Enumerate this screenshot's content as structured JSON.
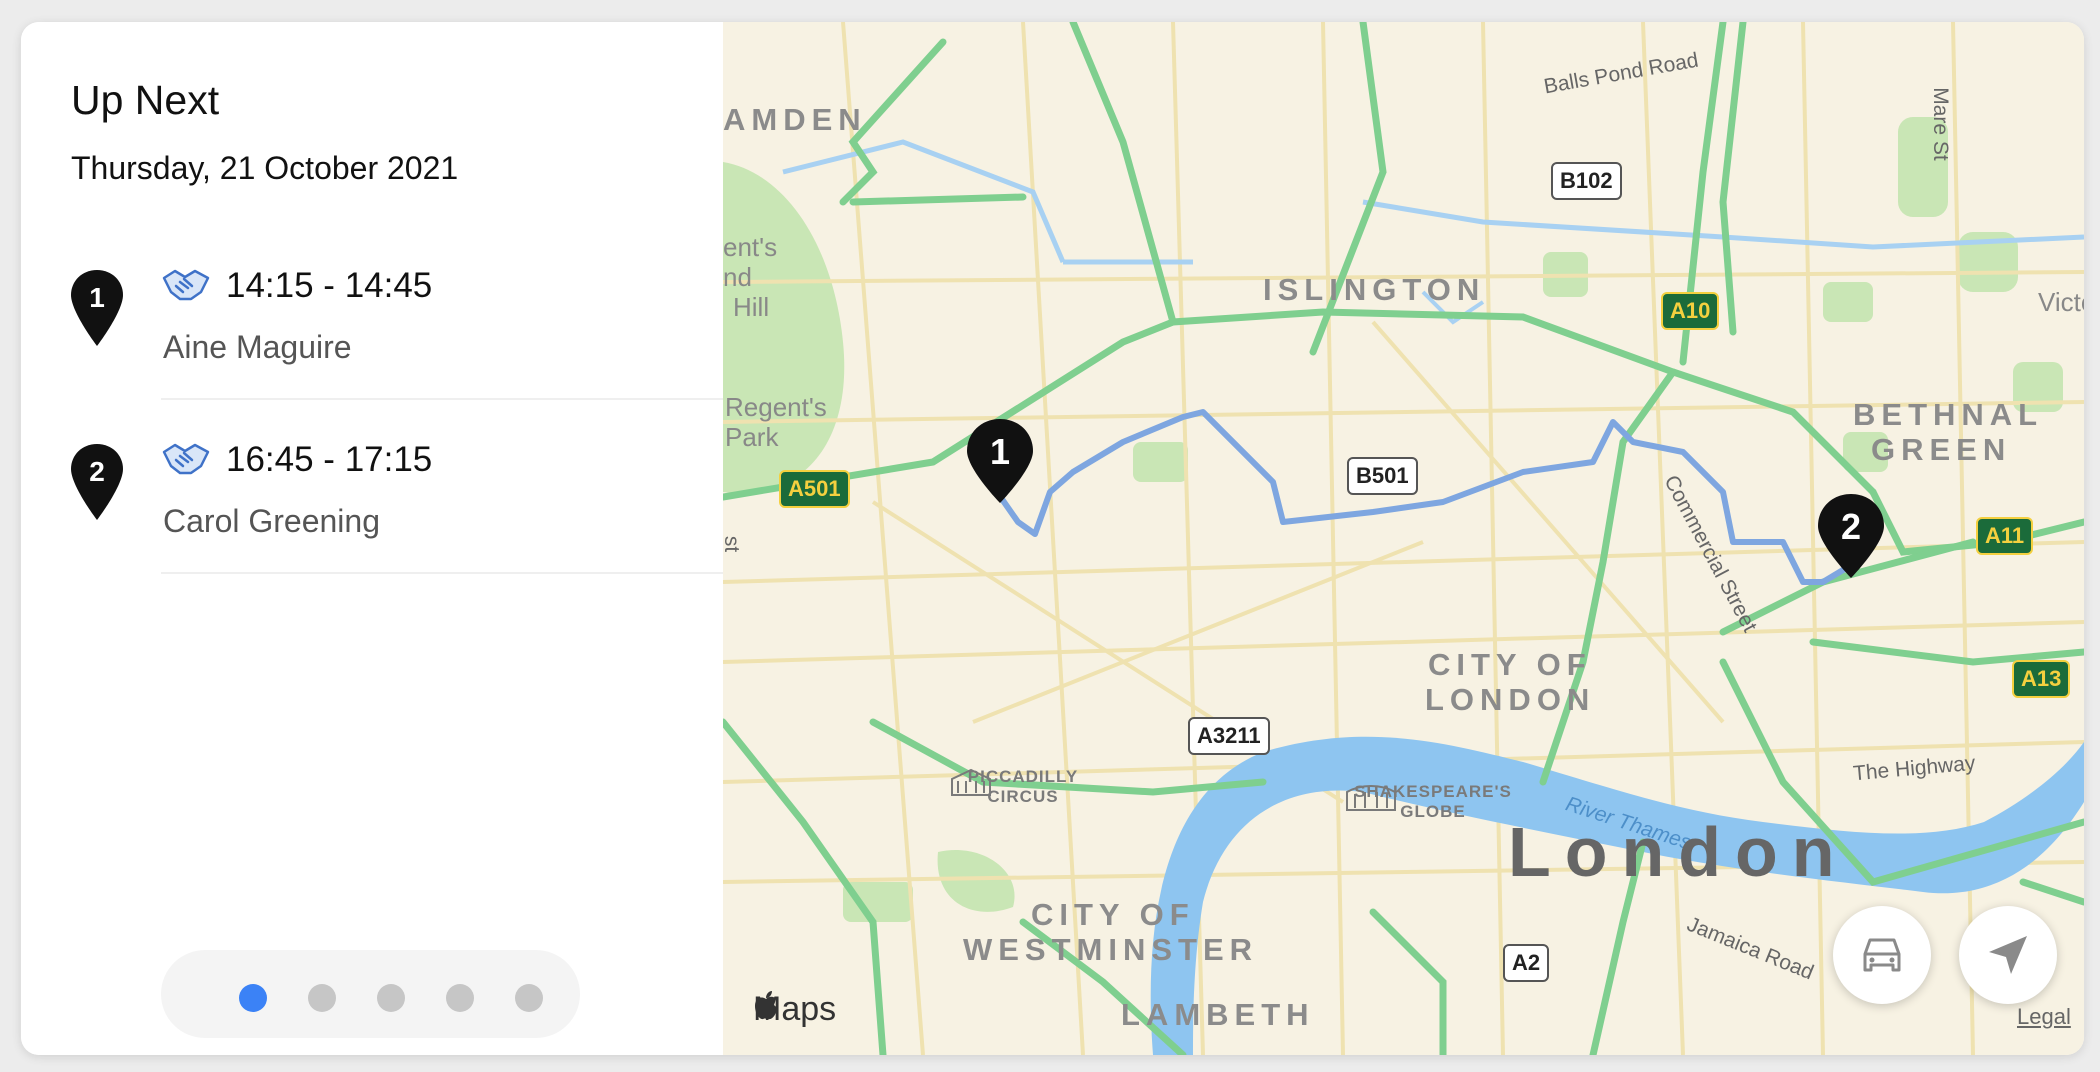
{
  "panel": {
    "title": "Up Next",
    "date": "Thursday, 21 October 2021",
    "items": [
      {
        "number": "1",
        "time": "14:15 - 14:45",
        "name": "Aine Maguire"
      },
      {
        "number": "2",
        "time": "16:45 - 17:15",
        "name": "Carol Greening"
      }
    ],
    "pages": {
      "count": 5,
      "active": 1
    }
  },
  "map": {
    "areas": {
      "camden": "AMDEN",
      "islington": "ISLINGTON",
      "bethnal_green_1": "BETHNAL",
      "bethnal_green_2": "GREEN",
      "city_of_london_1": "CITY OF",
      "city_of_london_2": "LONDON",
      "westminster_1": "CITY OF",
      "westminster_2": "WESTMINSTER",
      "lambeth": "LAMBETH",
      "victoria": "Victo",
      "regents_park_1": "Regent's",
      "regents_park_2": "Park",
      "kentish_1": "ent's",
      "kentish_2": "nd",
      "kentish_3": "Hill"
    },
    "roads": {
      "balls_pond": "Balls Pond Road",
      "mare_st": "Mare St",
      "commercial_st": "Commercial Street",
      "the_highway": "The Highway",
      "river_thames": "River Thames",
      "jamaica_rd": "Jamaica Road",
      "left_edge": "st"
    },
    "shields": {
      "b102": "B102",
      "a10": "A10",
      "a501": "A501",
      "b501": "B501",
      "a11": "A11",
      "a13": "A13",
      "a3211": "A3211",
      "a2": "A2"
    },
    "pois": {
      "piccadilly_1": "PICCADILLY",
      "piccadilly_2": "CIRCUS",
      "globe_1": "SHAKESPEARE'S",
      "globe_2": "GLOBE"
    },
    "city": "London",
    "pins": [
      "1",
      "2"
    ],
    "attribution": "Maps",
    "legal": "Legal",
    "icons": {
      "car": "car-icon",
      "location": "location-arrow-icon",
      "apple": "apple-logo-icon",
      "meeting": "handshake-icon",
      "pin": "map-pin-icon"
    },
    "colors": {
      "route": "#7ea6e0",
      "major_road": "#7fcf8f",
      "water": "#8ec5f0",
      "park": "#c9e6b5",
      "land": "#f7f2e3"
    }
  }
}
